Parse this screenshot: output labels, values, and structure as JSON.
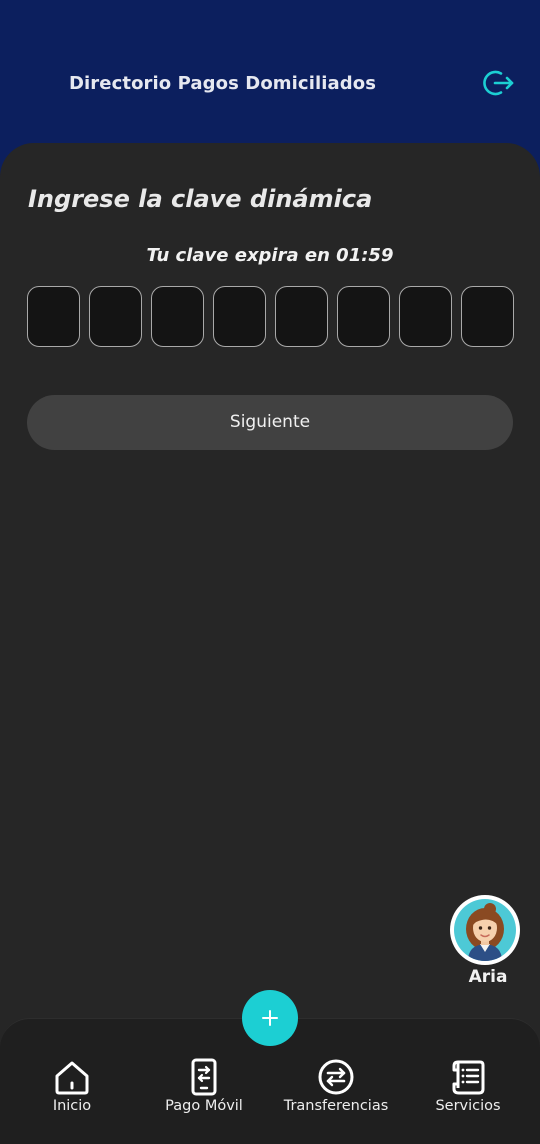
{
  "header": {
    "title": "Directorio Pagos Domiciliados",
    "logout_icon": "logout-icon",
    "accent_color": "#1ccfd3"
  },
  "otp": {
    "title": "Ingrese la clave dinámica",
    "timer_text": "Tu clave expira en 01:59",
    "digits": [
      "",
      "",
      "",
      "",
      "",
      "",
      "",
      ""
    ],
    "next_label": "Siguiente"
  },
  "assistant": {
    "name": "Aria",
    "avatar_icon": "assistant-avatar-icon"
  },
  "fab": {
    "icon": "plus-icon"
  },
  "nav": {
    "items": [
      {
        "label": "Inicio",
        "icon": "home-icon"
      },
      {
        "label": "Pago Móvil",
        "icon": "mobile-payment-icon"
      },
      {
        "label": "Transferencias",
        "icon": "transfer-icon"
      },
      {
        "label": "Servicios",
        "icon": "services-icon"
      }
    ]
  }
}
